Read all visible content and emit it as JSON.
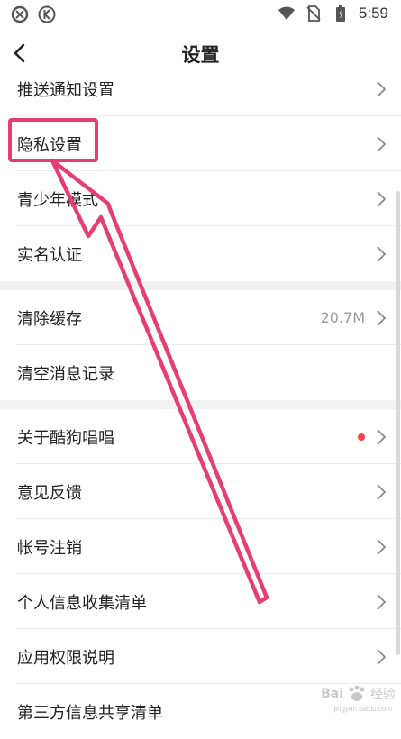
{
  "status_bar": {
    "time": "5:59"
  },
  "header": {
    "title": "设置"
  },
  "groups": [
    {
      "items": [
        {
          "label": "推送通知设置"
        },
        {
          "label": "隐私设置"
        },
        {
          "label": "青少年模式"
        },
        {
          "label": "实名认证"
        }
      ]
    },
    {
      "items": [
        {
          "label": "清除缓存",
          "value": "20.7M"
        },
        {
          "label": "清空消息记录"
        }
      ]
    },
    {
      "items": [
        {
          "label": "关于酷狗唱唱"
        },
        {
          "label": "意见反馈"
        },
        {
          "label": "帐号注销"
        },
        {
          "label": "个人信息收集清单"
        },
        {
          "label": "应用权限说明"
        },
        {
          "label": "第三方信息共享清单"
        }
      ]
    }
  ],
  "colors": {
    "annotation": "#e63e73",
    "dot": "#f0414d"
  },
  "watermark": {
    "brand": "Bai",
    "suffix": "经验",
    "url": "jingyan.baidu.com"
  }
}
